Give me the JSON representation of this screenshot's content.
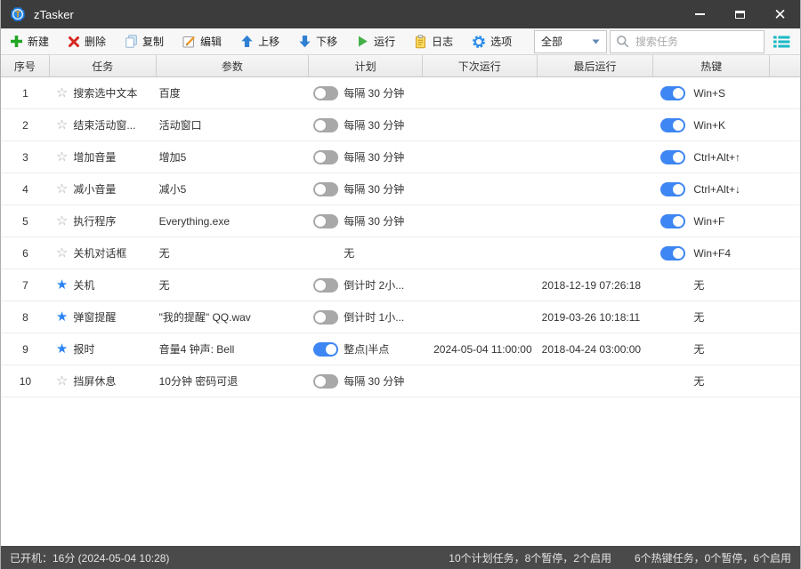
{
  "window": {
    "title": "zTasker"
  },
  "toolbar": {
    "buttons": [
      {
        "label": "新建",
        "icon": "plus-icon"
      },
      {
        "label": "删除",
        "icon": "delete-icon"
      },
      {
        "label": "复制",
        "icon": "copy-icon"
      },
      {
        "label": "编辑",
        "icon": "edit-icon"
      },
      {
        "label": "上移",
        "icon": "move-up-icon"
      },
      {
        "label": "下移",
        "icon": "move-down-icon"
      },
      {
        "label": "运行",
        "icon": "run-icon"
      },
      {
        "label": "日志",
        "icon": "log-icon"
      },
      {
        "label": "选项",
        "icon": "options-icon"
      }
    ],
    "filter_value": "全部",
    "search_placeholder": "搜索任务"
  },
  "table": {
    "columns": [
      "序号",
      "任务",
      "参数",
      "计划",
      "下次运行",
      "最后运行",
      "热键"
    ],
    "rows": [
      {
        "no": "1",
        "starred": false,
        "task": "搜索选中文本",
        "params": "百度",
        "plan_toggle": "off",
        "plan": "每隔 30 分钟",
        "next_run": "",
        "last_run": "",
        "hotkey_toggle": "on",
        "hotkey": "Win+S"
      },
      {
        "no": "2",
        "starred": false,
        "task": "结束活动窗...",
        "params": "活动窗口",
        "plan_toggle": "off",
        "plan": "每隔 30 分钟",
        "next_run": "",
        "last_run": "",
        "hotkey_toggle": "on",
        "hotkey": "Win+K"
      },
      {
        "no": "3",
        "starred": false,
        "task": "增加音量",
        "params": "增加5",
        "plan_toggle": "off",
        "plan": "每隔 30 分钟",
        "next_run": "",
        "last_run": "",
        "hotkey_toggle": "on",
        "hotkey": "Ctrl+Alt+↑"
      },
      {
        "no": "4",
        "starred": false,
        "task": "减小音量",
        "params": "减小5",
        "plan_toggle": "off",
        "plan": "每隔 30 分钟",
        "next_run": "",
        "last_run": "",
        "hotkey_toggle": "on",
        "hotkey": "Ctrl+Alt+↓"
      },
      {
        "no": "5",
        "starred": false,
        "task": "执行程序",
        "params": "Everything.exe",
        "plan_toggle": "off",
        "plan": "每隔 30 分钟",
        "next_run": "",
        "last_run": "",
        "hotkey_toggle": "on",
        "hotkey": "Win+F"
      },
      {
        "no": "6",
        "starred": false,
        "task": "关机对话框",
        "params": "无",
        "plan_toggle": null,
        "plan": "无",
        "next_run": "",
        "last_run": "",
        "hotkey_toggle": "on",
        "hotkey": "Win+F4"
      },
      {
        "no": "7",
        "starred": true,
        "task": "关机",
        "params": "无",
        "plan_toggle": "off",
        "plan": "倒计时 2小...",
        "next_run": "",
        "last_run": "2018-12-19 07:26:18",
        "hotkey_toggle": null,
        "hotkey": "无"
      },
      {
        "no": "8",
        "starred": true,
        "task": "弹窗提醒",
        "params": "\"我的提醒\" QQ.wav",
        "plan_toggle": "off",
        "plan": "倒计时 1小...",
        "next_run": "",
        "last_run": "2019-03-26 10:18:11",
        "hotkey_toggle": null,
        "hotkey": "无"
      },
      {
        "no": "9",
        "starred": true,
        "task": "报时",
        "params": "音量4 钟声: Bell",
        "plan_toggle": "on",
        "plan": "整点|半点",
        "next_run": "2024-05-04 11:00:00",
        "last_run": "2018-04-24 03:00:00",
        "hotkey_toggle": null,
        "hotkey": "无"
      },
      {
        "no": "10",
        "starred": false,
        "task": "挡屏休息",
        "params": "10分钟 密码可退",
        "plan_toggle": "off",
        "plan": "每隔 30 分钟",
        "next_run": "",
        "last_run": "",
        "hotkey_toggle": null,
        "hotkey": "无"
      }
    ]
  },
  "statusbar": {
    "left": "已开机：16分 (2024-05-04 10:28)",
    "plan_summary": "10个计划任务，8个暂停，2个启用",
    "hotkey_summary": "6个热键任务，0个暂停，6个启用"
  },
  "colors": {
    "titlebar": "#3c3c3c",
    "statusbar": "#4a4a4a",
    "toggle_on": "#3d86f3",
    "toggle_off": "#a8a8a8",
    "star_filled": "#2c85f5",
    "list_icon": "#19bac6"
  }
}
